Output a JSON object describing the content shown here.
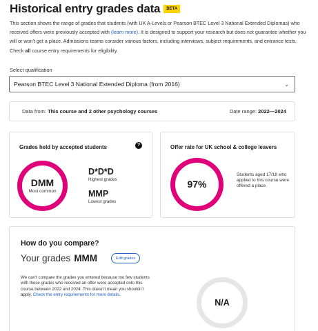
{
  "header": {
    "title": "Historical entry grades data",
    "badge": "BETA"
  },
  "intro": {
    "part1": "This section shows the range of grades that students (with UK A-Levels or Pearson BTEC Level 3 National Extended Diplomas) who received offers were previously accepted with ",
    "link": "(learn more)",
    "part2": ". It is designed to support your research but does not guarantee whether you will or won't get a place. Admissions teams consider various factors, including interviews, subject requirements, and entrance tests. Check ",
    "bold": "all",
    "part3": " course entry requirements for eligibility."
  },
  "qualification": {
    "label": "Select qualification",
    "selected": "Pearson BTEC Level 3 National Extended Diploma (from 2016)"
  },
  "data_source": {
    "prefix": "Data from: ",
    "value": "This course and 2 other psychology courses",
    "range_label": "Date range: ",
    "range_value": "2022—2024"
  },
  "grades_card": {
    "title": "Grades held by accepted students",
    "help_icon": "?",
    "most_common_value": "DMM",
    "most_common_label": "Most common",
    "highest_value": "D*D*D",
    "highest_label": "Highest grades",
    "lowest_value": "MMP",
    "lowest_label": "Lowest grades",
    "ring_color": "#e0007a"
  },
  "offer_card": {
    "title": "Offer rate for UK school & college leavers",
    "value": "97%",
    "description": "Students aged 17/18 who applied to this course were offered a place."
  },
  "compare": {
    "title": "How do you compare?",
    "your_grades_label": "Your grades",
    "your_grades_value": "MMM",
    "edit_button": "Edit grades",
    "text": "We can't compare the grades you entered because too few students with these grades who received an offer were accepted onto this course between 2022 and 2024. This doesn't mean you shouldn't apply. ",
    "link": "Check the entry requirements for more details.",
    "result": "N/A"
  }
}
